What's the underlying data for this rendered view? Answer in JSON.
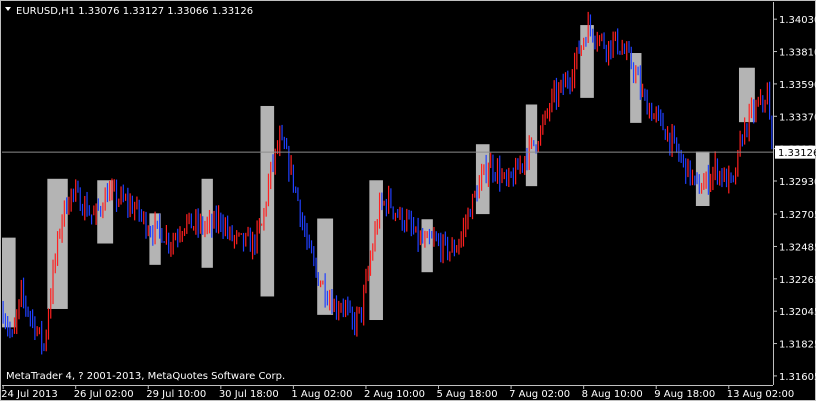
{
  "window": {
    "symbol_line": "EURUSD,H1  1.33076 1.33127 1.33066 1.33126",
    "copyright": "MetaTrader 4, ? 2001-2013, MetaQuotes Software Corp.",
    "current_price_label": "1.33126"
  },
  "colors": {
    "background": "#000000",
    "frame": "#c0c0c0",
    "bull": "#ff2020",
    "bear": "#2040ff",
    "range_box": "#b4b4b4",
    "price_line": "#8c8c8c",
    "price_label_bg": "#ffffff",
    "price_label_fg": "#000000",
    "text": "#ffffff"
  },
  "chart_data": {
    "type": "line",
    "title": "EURUSD,H1  1.33076 1.33127 1.33066 1.33126",
    "ylim": [
      1.3155,
      1.3414
    ],
    "y_ticks": [
      "1.34030",
      "1.33810",
      "1.33590",
      "1.33370",
      "1.33150",
      "1.32930",
      "1.32705",
      "1.32485",
      "1.32265",
      "1.32045",
      "1.31825",
      "1.31605"
    ],
    "y_tick_values": [
      1.3403,
      1.3381,
      1.3359,
      1.3337,
      1.3315,
      1.3293,
      1.32705,
      1.32485,
      1.32265,
      1.32045,
      1.31825,
      1.31605
    ],
    "x_ticks": [
      "24 Jul 2013",
      "26 Jul 02:00",
      "29 Jul 10:00",
      "30 Jul 18:00",
      "1 Aug 02:00",
      "2 Aug 10:00",
      "5 Aug 18:00",
      "7 Aug 02:00",
      "8 Aug 10:00",
      "9 Aug 18:00",
      "13 Aug 02:00"
    ],
    "x_tick_bars": [
      0,
      32,
      64,
      96,
      128,
      160,
      192,
      224,
      256,
      288,
      320
    ],
    "bar_count": 340,
    "current_price": 1.33126,
    "anchors": [
      [
        0,
        1.3205
      ],
      [
        4,
        1.3185
      ],
      [
        8,
        1.3215
      ],
      [
        14,
        1.3195
      ],
      [
        18,
        1.318
      ],
      [
        22,
        1.323
      ],
      [
        26,
        1.327
      ],
      [
        30,
        1.3285
      ],
      [
        34,
        1.328
      ],
      [
        40,
        1.3268
      ],
      [
        46,
        1.3285
      ],
      [
        52,
        1.328
      ],
      [
        58,
        1.3275
      ],
      [
        64,
        1.3262
      ],
      [
        70,
        1.3258
      ],
      [
        74,
        1.3252
      ],
      [
        80,
        1.3265
      ],
      [
        86,
        1.3262
      ],
      [
        92,
        1.3262
      ],
      [
        96,
        1.3268
      ],
      [
        100,
        1.3255
      ],
      [
        104,
        1.3252
      ],
      [
        110,
        1.325
      ],
      [
        114,
        1.3262
      ],
      [
        118,
        1.33
      ],
      [
        122,
        1.332
      ],
      [
        126,
        1.3305
      ],
      [
        130,
        1.328
      ],
      [
        134,
        1.325
      ],
      [
        138,
        1.323
      ],
      [
        142,
        1.322
      ],
      [
        146,
        1.3208
      ],
      [
        150,
        1.321
      ],
      [
        154,
        1.3195
      ],
      [
        158,
        1.3205
      ],
      [
        162,
        1.324
      ],
      [
        166,
        1.3275
      ],
      [
        170,
        1.328
      ],
      [
        174,
        1.327
      ],
      [
        178,
        1.3265
      ],
      [
        182,
        1.3255
      ],
      [
        186,
        1.325
      ],
      [
        190,
        1.3252
      ],
      [
        194,
        1.3248
      ],
      [
        198,
        1.3245
      ],
      [
        202,
        1.3255
      ],
      [
        206,
        1.3275
      ],
      [
        210,
        1.329
      ],
      [
        214,
        1.3305
      ],
      [
        218,
        1.33
      ],
      [
        222,
        1.329
      ],
      [
        226,
        1.3298
      ],
      [
        230,
        1.331
      ],
      [
        234,
        1.3318
      ],
      [
        238,
        1.333
      ],
      [
        242,
        1.3348
      ],
      [
        246,
        1.3355
      ],
      [
        250,
        1.3365
      ],
      [
        254,
        1.3382
      ],
      [
        258,
        1.3398
      ],
      [
        262,
        1.3392
      ],
      [
        266,
        1.3385
      ],
      [
        270,
        1.3388
      ],
      [
        274,
        1.338
      ],
      [
        278,
        1.337
      ],
      [
        282,
        1.335
      ],
      [
        286,
        1.334
      ],
      [
        290,
        1.3332
      ],
      [
        294,
        1.3322
      ],
      [
        298,
        1.331
      ],
      [
        302,
        1.33
      ],
      [
        306,
        1.3288
      ],
      [
        310,
        1.3292
      ],
      [
        314,
        1.3302
      ],
      [
        318,
        1.3295
      ],
      [
        322,
        1.329
      ],
      [
        326,
        1.3325
      ],
      [
        330,
        1.3338
      ],
      [
        334,
        1.3345
      ],
      [
        337,
        1.3352
      ],
      [
        339,
        1.33126
      ]
    ],
    "range_boxes": [
      {
        "start": 0,
        "end": 5,
        "high": 1.32545,
        "low": 1.31935
      },
      {
        "start": 20,
        "end": 28,
        "high": 1.32945,
        "low": 1.3206
      },
      {
        "start": 42,
        "end": 48,
        "high": 1.32935,
        "low": 1.32505
      },
      {
        "start": 65,
        "end": 69,
        "high": 1.3271,
        "low": 1.3236
      },
      {
        "start": 88,
        "end": 92,
        "high": 1.32945,
        "low": 1.3234
      },
      {
        "start": 114,
        "end": 119,
        "high": 1.3344,
        "low": 1.32145
      },
      {
        "start": 139,
        "end": 145,
        "high": 1.32675,
        "low": 1.3202
      },
      {
        "start": 162,
        "end": 167,
        "high": 1.32935,
        "low": 1.31985
      },
      {
        "start": 185,
        "end": 189,
        "high": 1.3267,
        "low": 1.3231
      },
      {
        "start": 209,
        "end": 214,
        "high": 1.3318,
        "low": 1.32705
      },
      {
        "start": 231,
        "end": 235,
        "high": 1.3345,
        "low": 1.32895
      },
      {
        "start": 255,
        "end": 260,
        "high": 1.3399,
        "low": 1.33495
      },
      {
        "start": 277,
        "end": 281,
        "high": 1.338,
        "low": 1.33325
      },
      {
        "start": 306,
        "end": 311,
        "high": 1.3313,
        "low": 1.3276
      },
      {
        "start": 325,
        "end": 331,
        "high": 1.337,
        "low": 1.3333
      }
    ]
  }
}
